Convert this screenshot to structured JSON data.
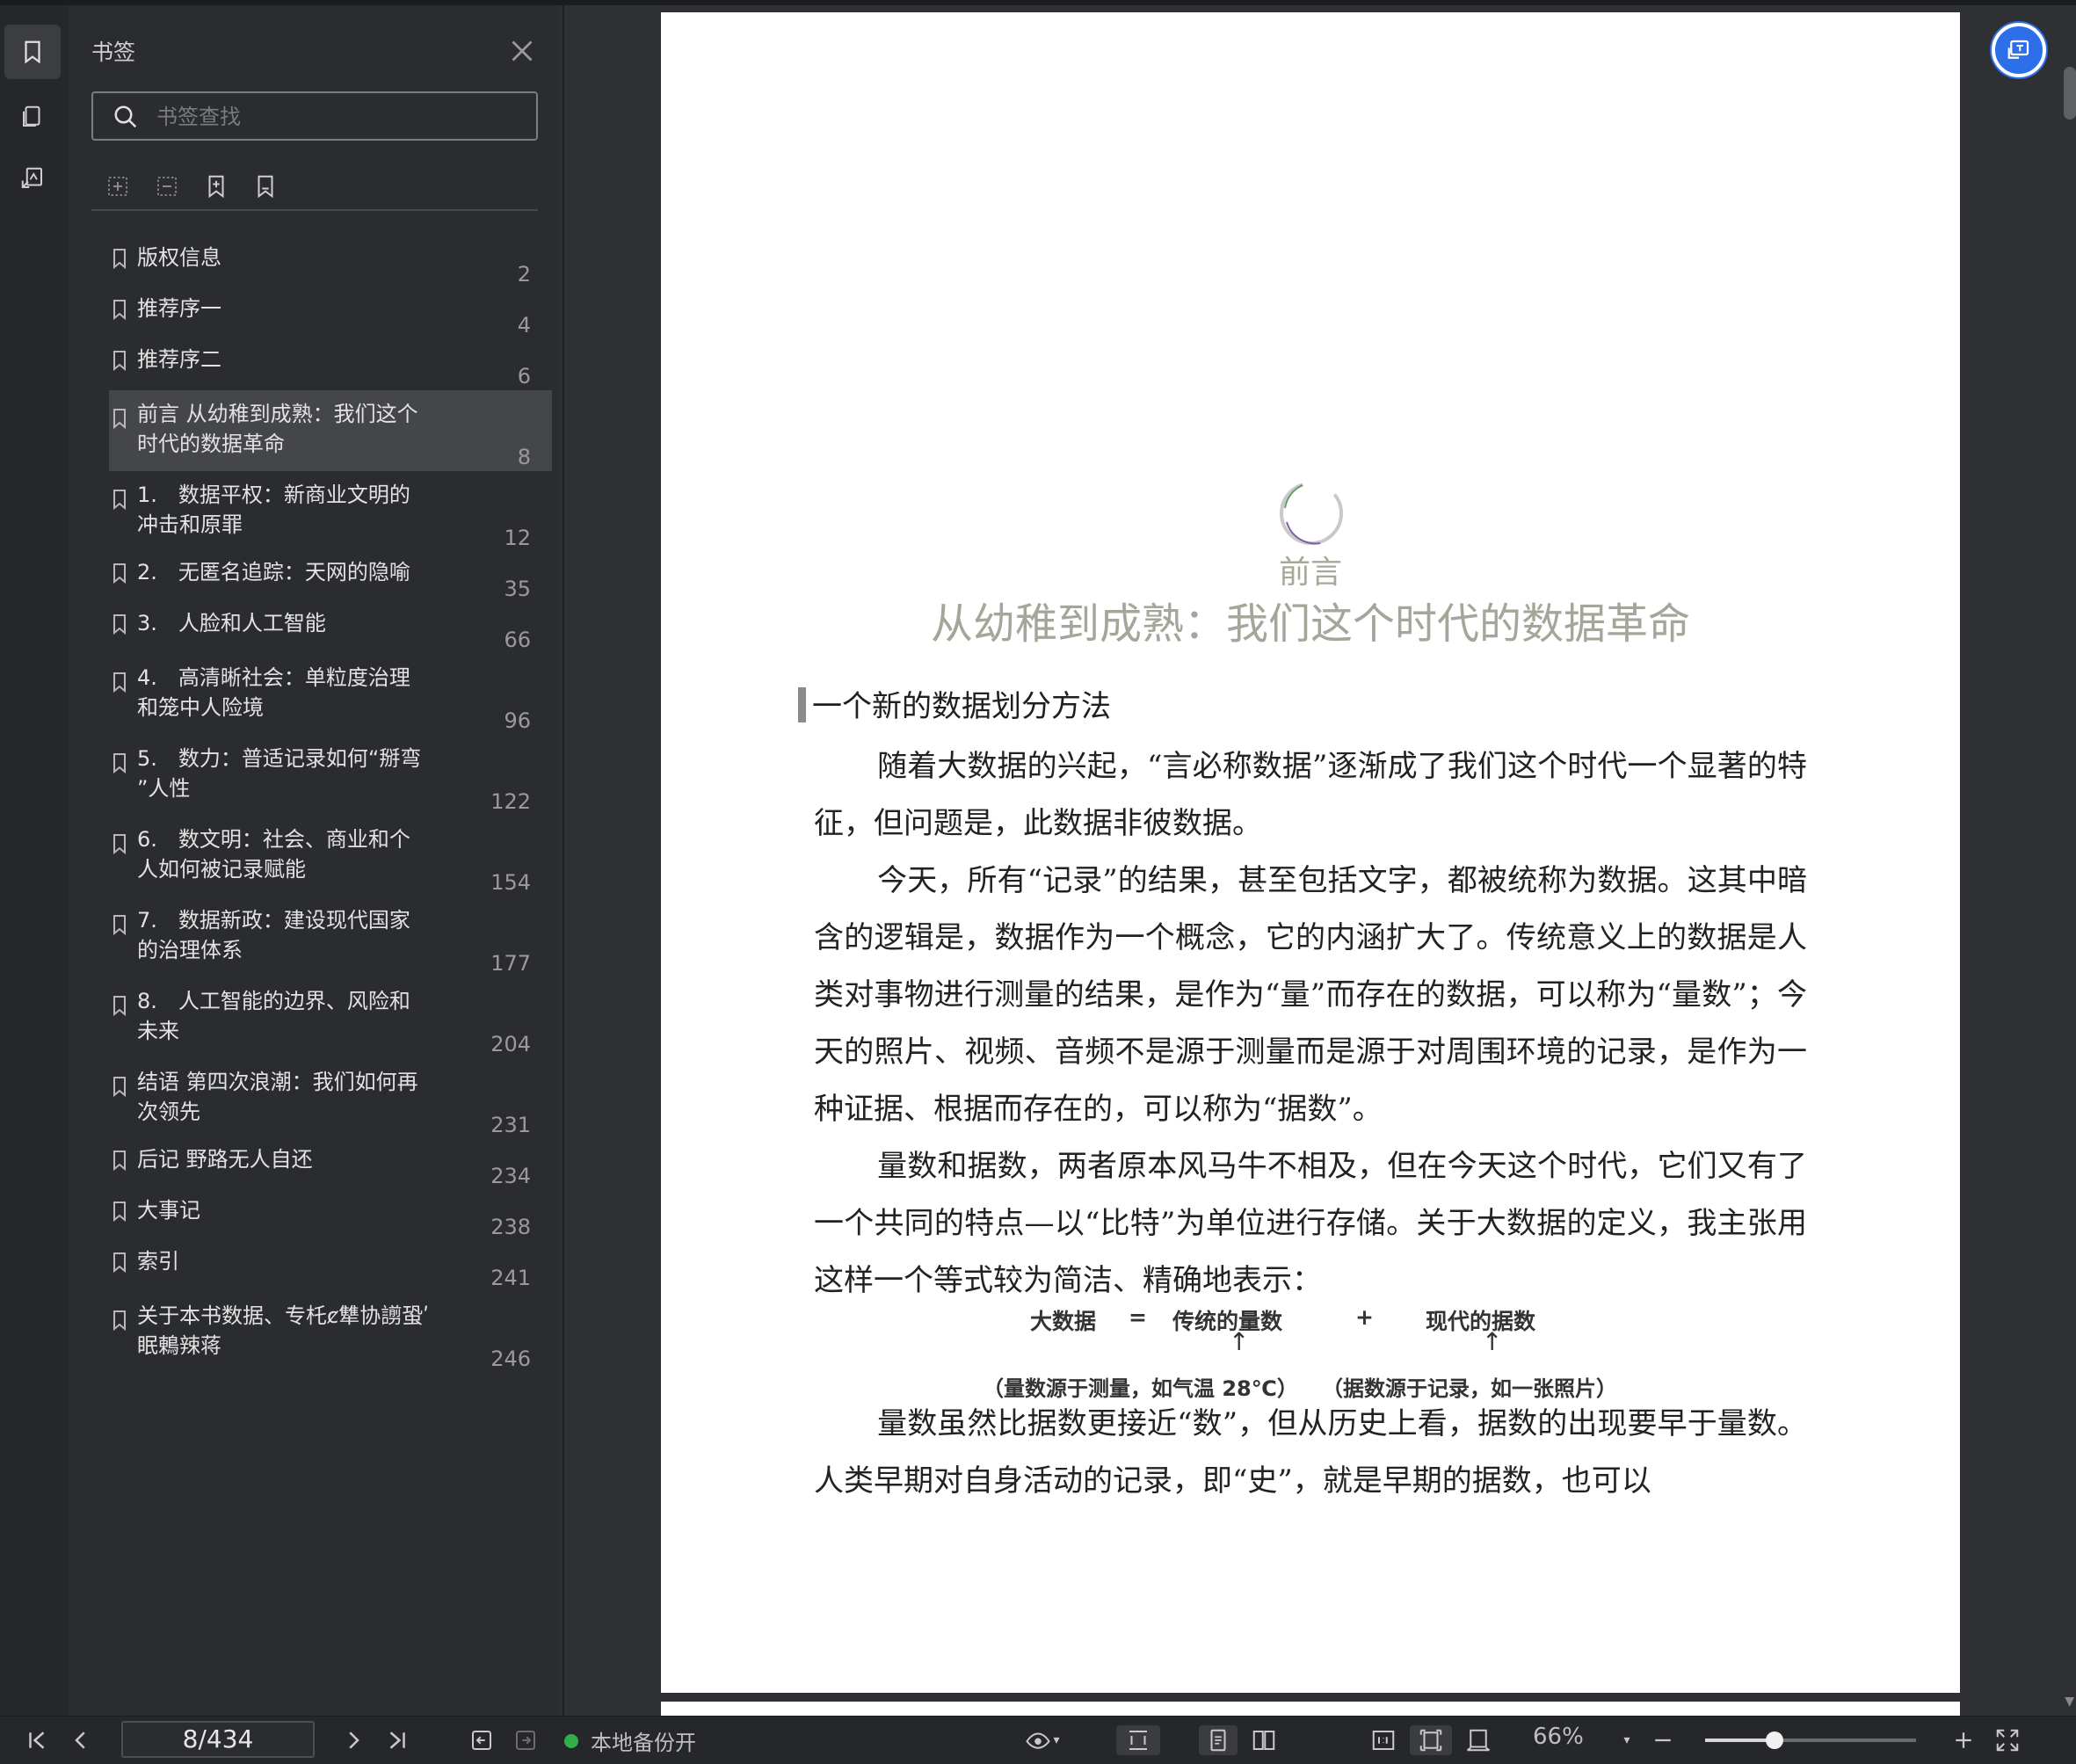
{
  "sidebar": {
    "title": "书签",
    "search_placeholder": "书签查找",
    "rail_icons": [
      "bookmark-icon",
      "pages-icon",
      "annotation-icon"
    ],
    "tool_icons": [
      "expand-all-icon",
      "collapse-all-icon",
      "add-bookmark-icon",
      "bookmark-outline-icon"
    ],
    "bookmarks": [
      {
        "label": "版权信息",
        "page": "2"
      },
      {
        "label": "推荐序一",
        "page": "4"
      },
      {
        "label": "推荐序二",
        "page": "6"
      },
      {
        "label": "前言 从幼稚到成熟：我们这个\n时代的数据革命",
        "page": "8",
        "active": true
      },
      {
        "label": "1.　数据平权：新商业文明的\n冲击和原罪",
        "page": "12"
      },
      {
        "label": "2.　无匿名追踪：天网的隐喻",
        "page": "35"
      },
      {
        "label": "3.　人脸和人工智能",
        "page": "66"
      },
      {
        "label": "4.　高清晰社会：单粒度治理\n和笼中人险境",
        "page": "96"
      },
      {
        "label": "5.　数力：普适记录如何“掰弯\n”人性",
        "page": "122"
      },
      {
        "label": "6.　数文明：社会、商业和个\n人如何被记录赋能",
        "page": "154"
      },
      {
        "label": "7.　数据新政：建设现代国家\n的治理体系",
        "page": "177"
      },
      {
        "label": "8.　人工智能的边界、风险和\n未来",
        "page": "204"
      },
      {
        "label": "结语 第四次浪潮：我们如何再\n次领先",
        "page": "231"
      },
      {
        "label": "后记 野路无人自还",
        "page": "234"
      },
      {
        "label": "大事记",
        "page": "238"
      },
      {
        "label": "索引",
        "page": "241"
      },
      {
        "label": "关于本书数据、专杔ȼ犨协謭蛩ʹ\n眠鶇辣蒋",
        "page": "246"
      }
    ]
  },
  "document": {
    "chapter_label": "前言",
    "chapter_title": "从幼稚到成熟：我们这个时代的数据革命",
    "section_heading": "一个新的数据划分方法",
    "paragraphs": [
      "随着大数据的兴起，“言必称数据”逐渐成了我们这个时代一个显著的特征，但问题是，此数据非彼数据。",
      "今天，所有“记录”的结果，甚至包括文字，都被统称为数据。这其中暗含的逻辑是，数据作为一个概念，它的内涵扩大了。传统意义上的数据是人类对事物进行测量的结果，是作为“量”而存在的数据，可以称为“量数”；今天的照片、视频、音频不是源于测量而是源于对周围环境的记录，是作为一种证据、根据而存在的，可以称为“据数”。",
      "量数和据数，两者原本风马牛不相及，但在今天这个时代，它们又有了一个共同的特点—以“比特”为单位进行存储。关于大数据的定义，我主张用这样一个等式较为简洁、精确地表示：",
      "量数虽然比据数更接近“数”，但从历史上看，据数的出现要早于量数。人类早期对自身活动的记录，即“史”，就是早期的据数，也可以"
    ],
    "formula": {
      "lhs": "大数据",
      "eq": "=",
      "term1": "传统的量数",
      "plus": "+",
      "term2": "现代的据数",
      "note1": "（量数源于测量，如气温 28℃）",
      "note2": "（据数源于记录，如一张照片）"
    }
  },
  "statusbar": {
    "page_indicator": "8/434",
    "backup_status": "本地备份开",
    "zoom": "66%",
    "zoom_fraction": 0.33
  }
}
